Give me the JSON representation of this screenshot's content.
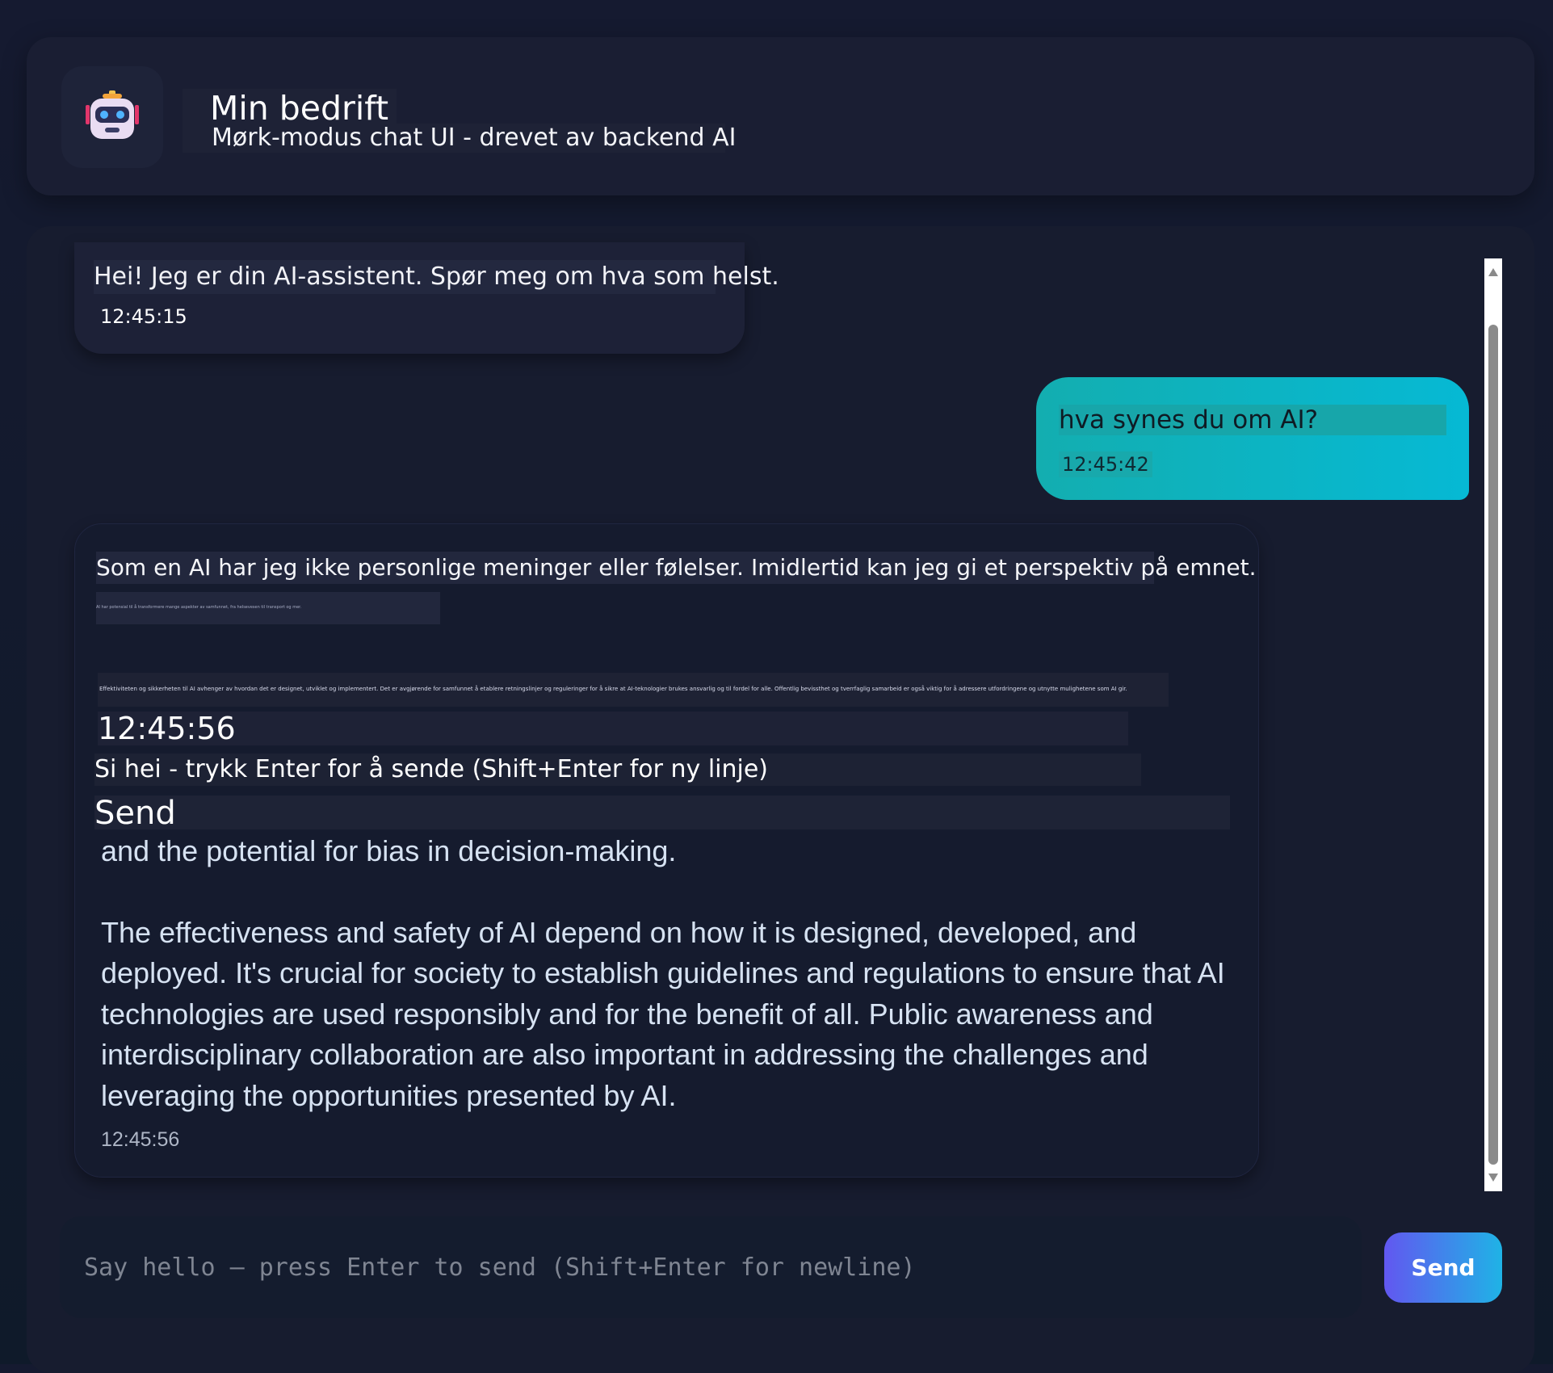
{
  "header": {
    "icon": "robot-icon",
    "title": "Min bedrift",
    "subtitle": "Mørk-modus chat UI - drevet av backend AI"
  },
  "messages": [
    {
      "role": "assistant",
      "text": "Hei! Jeg er din AI-assistent. Spør meg om hva som helst.",
      "time": "12:45:15"
    },
    {
      "role": "user",
      "text": "hva synes du om AI?",
      "time": "12:45:42"
    },
    {
      "role": "assistant",
      "line1": "Som en AI har jeg ikke personlige meninger eller følelser. Imidlertid kan jeg gi et perspektiv på emnet.",
      "tiny1": "AI har potensial til å transformere mange aspekter av samfunnet, fra helsevesen til transport og mer.",
      "tiny2": "Effektiviteten og sikkerheten til AI avhenger av hvordan det er designet, utviklet og implementert. Det er avgjørende for samfunnet å etablere retningslinjer og reguleringer for å sikre at AI-teknologier brukes ansvarlig og til fordel for alle. Offentlig bevissthet og tverrfaglig samarbeid er også viktig for å adressere utfordringene og utnytte mulighetene som AI gir.",
      "time_overlay": "12:45:56",
      "hint_overlay": "Si hei - trykk Enter for å sende (Shift+Enter for ny linje)",
      "send_overlay": "Send",
      "body_p1": "and the potential for bias in decision-making.",
      "body_p2": "The effectiveness and safety of AI depend on how it is designed, developed, and deployed. It's crucial for society to establish guidelines and regulations to ensure that AI technologies are used responsibly and for the benefit of all. Public awareness and interdisciplinary collaboration are also important in addressing the challenges and leveraging the opportunities presented by AI.",
      "time": "12:45:56"
    }
  ],
  "composer": {
    "placeholder": "Say hello — press Enter to send (Shift+Enter for newline)",
    "value": "",
    "send_label": "Send"
  },
  "colors": {
    "background": "#151a30",
    "panel": "#1a1e33",
    "user_bubble_start": "#13aeb0",
    "user_bubble_end": "#06b9d4",
    "send_start": "#6257f0",
    "send_end": "#1fb3e6"
  }
}
